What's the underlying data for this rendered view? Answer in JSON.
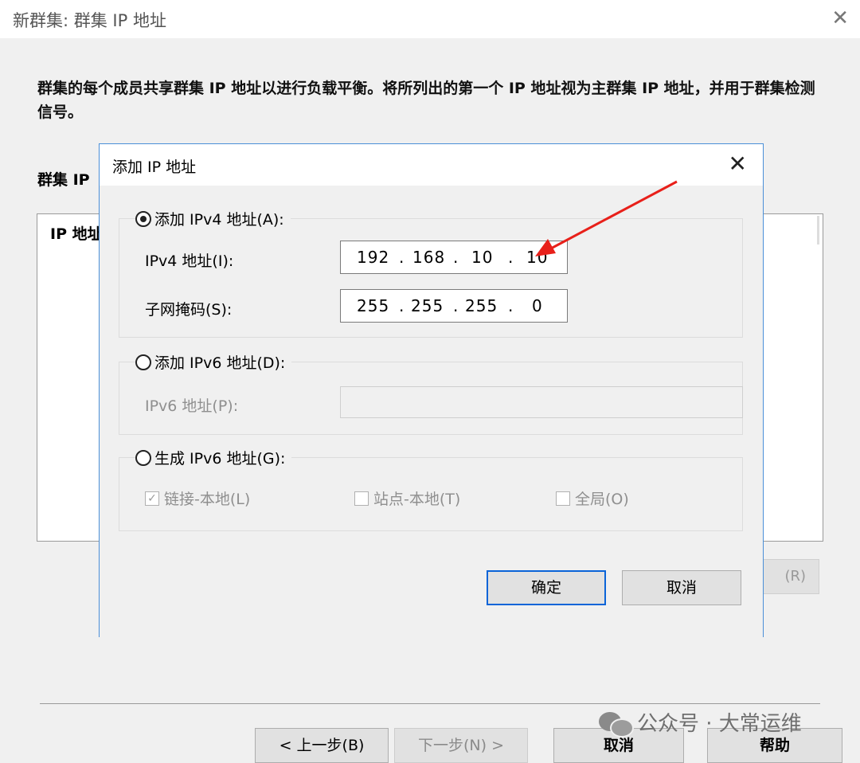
{
  "wizard": {
    "title": "新群集: 群集 IP 地址",
    "close_glyph": "✕",
    "description": "群集的每个成员共享群集 IP 地址以进行负载平衡。将所列出的第一个 IP 地址视为主群集 IP 地址，并用于群集检测信号。",
    "list_label": "群集 IP",
    "list_column": "IP 地址",
    "remove_fragment": "(R)",
    "buttons": {
      "back": "< 上一步(B)",
      "next": "下一步(N) >",
      "cancel": "取消",
      "help": "帮助"
    }
  },
  "dialog": {
    "title": "添加 IP 地址",
    "close_glyph": "✕",
    "ipv4_option": "添加 IPv4 地址(A):",
    "ipv4_selected": true,
    "ipv4_address_label": "IPv4 地址(I):",
    "ipv4_octets": [
      "192",
      "168",
      "10",
      "10"
    ],
    "subnet_label": "子网掩码(S):",
    "subnet_octets": [
      "255",
      "255",
      "255",
      "0"
    ],
    "ipv6_option": "添加 IPv6 地址(D):",
    "ipv6_address_label": "IPv6 地址(P):",
    "ipv6_address_value": "",
    "gen_option": "生成 IPv6 地址(G):",
    "link_local": {
      "label": "链接-本地(L)",
      "checked": true
    },
    "site_local": {
      "label": "站点-本地(T)",
      "checked": false
    },
    "global": {
      "label": "全局(O)",
      "checked": false
    },
    "ok": "确定",
    "cancel": "取消"
  },
  "watermark": "公众号 · 大常运维",
  "colors": {
    "accent_border": "#0a64d8",
    "annotation_arrow": "#e8201a",
    "disabled_text": "#8f8f8f"
  }
}
